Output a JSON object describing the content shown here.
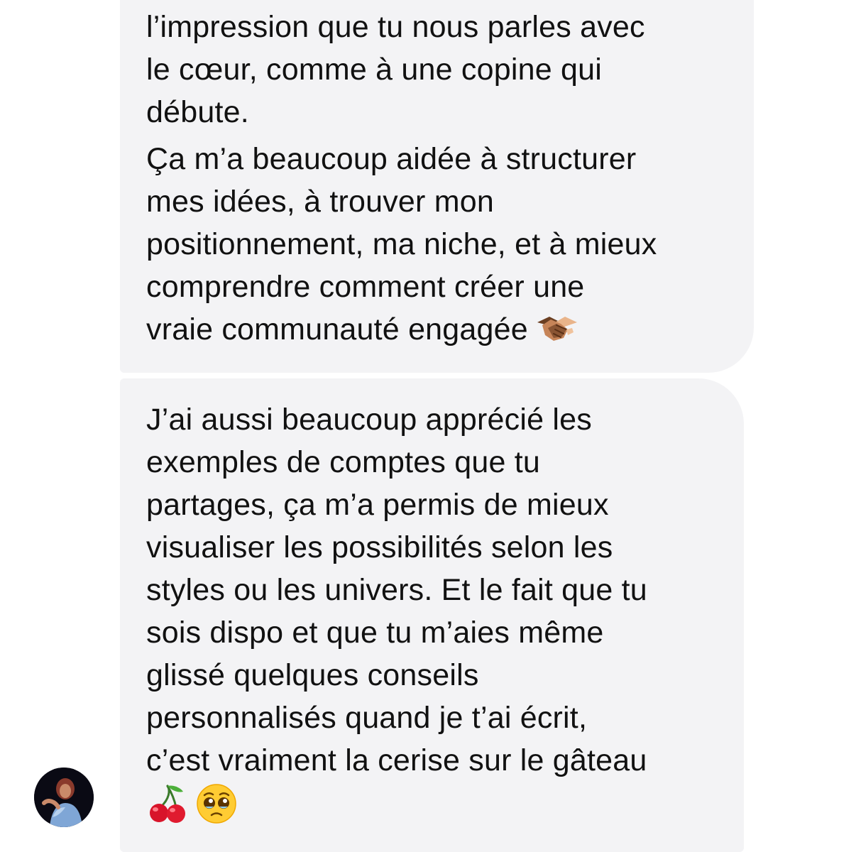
{
  "conversation": {
    "messages": [
      {
        "paragraphs": [
          "l’impression que tu nous parles avec\nle cœur, comme à une copine qui\ndébute.",
          "Ça m’a beaucoup aidée à structurer\nmes idées, à trouver mon\npositionnement, ma niche, et à mieux\ncomprendre comment créer une\nvraie communauté engagée"
        ],
        "trailing_emoji": "handshake-icon"
      },
      {
        "paragraphs": [
          "J’ai aussi beaucoup apprécié les\nexemples de comptes que tu\npartages, ça m’a permis de mieux\nvisualiser les possibilités selon les\nstyles ou les univers. Et le fait que tu\nsois dispo et que tu m’aies même\nglissé quelques conseils\npersonnalisés quand je t’ai écrit,\nc’est vraiment la cerise sur le gâteau"
        ],
        "trailing_emojis": [
          "cherries-icon",
          "pleading-face-icon"
        ]
      }
    ],
    "sender_avatar": "sender-avatar"
  },
  "colors": {
    "bubble_background": "#f3f3f5",
    "text": "#111111",
    "page_background": "#ffffff"
  }
}
